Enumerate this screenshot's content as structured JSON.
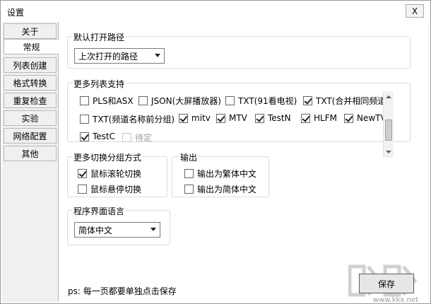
{
  "window": {
    "title": "设置",
    "close_label": "X"
  },
  "tabs": [
    {
      "label": "关于",
      "active": false
    },
    {
      "label": "常规",
      "active": true
    },
    {
      "label": "列表创建",
      "active": false
    },
    {
      "label": "格式转换",
      "active": false
    },
    {
      "label": "重复检查",
      "active": false
    },
    {
      "label": "实验",
      "active": false
    },
    {
      "label": "网络配置",
      "active": false
    },
    {
      "label": "其他",
      "active": false
    }
  ],
  "default_path": {
    "title": "默认打开路径",
    "value": "上次打开的路径"
  },
  "list_support": {
    "title": "更多列表支持",
    "items": [
      {
        "label": "PLS和ASX",
        "checked": false
      },
      {
        "label": "JSON(大屏播放器)",
        "checked": false
      },
      {
        "label": "TXT(91看电视)",
        "checked": false
      },
      {
        "label": "TXT(合并相同频道)",
        "checked": true
      },
      {
        "label": "TXT(频道名称前分组)",
        "checked": false
      },
      {
        "label": "mitv",
        "checked": true
      },
      {
        "label": "MTV",
        "checked": true
      },
      {
        "label": "TestN",
        "checked": true
      },
      {
        "label": "HLFM",
        "checked": true
      },
      {
        "label": "NewTV",
        "checked": true
      },
      {
        "label": "TestC",
        "checked": true
      },
      {
        "label": "待定",
        "checked": false,
        "disabled": true
      }
    ]
  },
  "group_switch": {
    "title": "更多切换分组方式",
    "items": [
      {
        "label": "鼠标滚轮切换",
        "checked": true
      },
      {
        "label": "鼠标悬停切换",
        "checked": false
      }
    ]
  },
  "output": {
    "title": "输出",
    "items": [
      {
        "label": "输出为繁体中文",
        "checked": false
      },
      {
        "label": "输出为简体中文",
        "checked": false
      }
    ]
  },
  "ui_language": {
    "title": "程序界面语言",
    "value": "简体中文"
  },
  "footer": {
    "note": "ps: 每一页都要单独点击保存",
    "save_label": "保存",
    "watermark_url": "www.kkx.net"
  }
}
